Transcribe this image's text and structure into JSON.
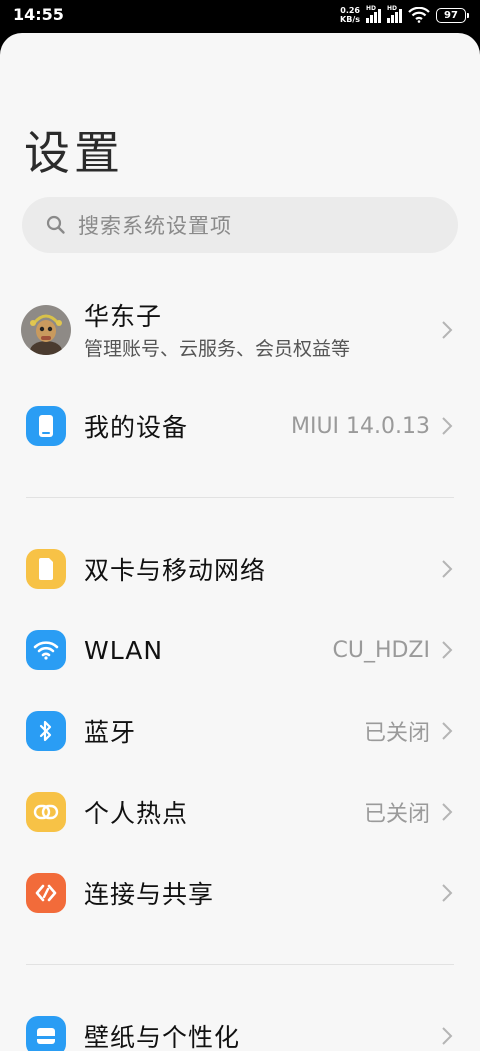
{
  "status_bar": {
    "time": "14:55",
    "net_speed_value": "0.26",
    "net_speed_unit": "KB/s",
    "sim1_tag": "HD",
    "sim2_tag": "HD",
    "battery": "97"
  },
  "page": {
    "title": "设置"
  },
  "search": {
    "placeholder": "搜索系统设置项"
  },
  "account": {
    "name": "华东子",
    "subtitle": "管理账号、云服务、会员权益等"
  },
  "items": {
    "my_device": {
      "label": "我的设备",
      "value": "MIUI 14.0.13",
      "icon": "phone-icon",
      "color": "#2a9df4"
    },
    "sim": {
      "label": "双卡与移动网络",
      "value": "",
      "icon": "sim-card-icon",
      "color": "#f7c246"
    },
    "wlan": {
      "label": "WLAN",
      "value": "CU_HDZI",
      "icon": "wifi-icon",
      "color": "#2a9df4"
    },
    "bluetooth": {
      "label": "蓝牙",
      "value": "已关闭",
      "icon": "bluetooth-icon",
      "color": "#2a9df4"
    },
    "hotspot": {
      "label": "个人热点",
      "value": "已关闭",
      "icon": "hotspot-icon",
      "color": "#f7c246"
    },
    "share": {
      "label": "连接与共享",
      "value": "",
      "icon": "share-icon",
      "color": "#f26b3a"
    },
    "wallpaper": {
      "label": "壁纸与个性化",
      "value": "",
      "icon": "wallpaper-icon",
      "color": "#2a9df4"
    }
  }
}
